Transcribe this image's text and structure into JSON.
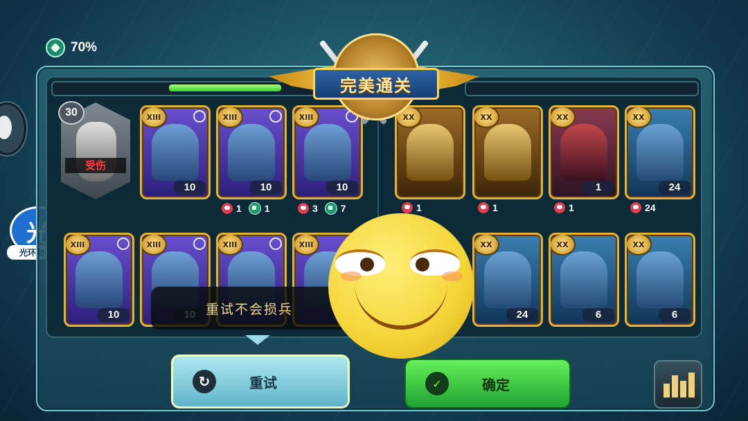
{
  "stat": {
    "icon": "shield-icon",
    "percent": "70%"
  },
  "banner": {
    "title": "完美通关"
  },
  "assistant": {
    "char": "光",
    "label": "光环助手"
  },
  "progress": {
    "left_fill_fraction": 0.4
  },
  "left_cards": {
    "hero": {
      "level": "30",
      "status": "受伤"
    },
    "row1": [
      {
        "rank": "XIII",
        "count": "10",
        "kills": null,
        "heals": null
      },
      {
        "rank": "XIII",
        "count": "10",
        "kills": "1",
        "heals": "1"
      },
      {
        "rank": "XIII",
        "count": "10",
        "kills": "3",
        "heals": "7"
      }
    ],
    "row2": [
      {
        "rank": "XIII",
        "count": "10"
      },
      {
        "rank": "XIII",
        "count": "10"
      },
      {
        "rank": "XIII",
        "count": ""
      },
      {
        "rank": "XIII",
        "count": ""
      }
    ]
  },
  "right_cards": {
    "row1": [
      {
        "rank": "XX",
        "count": "",
        "kills": "1"
      },
      {
        "rank": "XX",
        "count": "",
        "kills": "1"
      },
      {
        "rank": "XX",
        "count": "1",
        "kills": "1"
      },
      {
        "rank": "XX",
        "count": "24",
        "kills": "24"
      }
    ],
    "row2": [
      {
        "rank": "XX",
        "count": "24"
      },
      {
        "rank": "XX",
        "count": "6"
      },
      {
        "rank": "XX",
        "count": "6"
      }
    ]
  },
  "tooltip": {
    "text": "重试不会损兵"
  },
  "buttons": {
    "retry": "重试",
    "confirm": "确定"
  }
}
